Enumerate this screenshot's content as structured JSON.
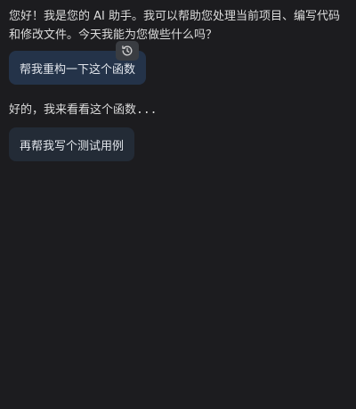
{
  "messages": [
    {
      "role": "assistant",
      "text": "您好！我是您的 AI 助手。我可以帮助您处理当前项目、编写代码和修改文件。今天我能为您做些什么吗？"
    },
    {
      "role": "user",
      "text": "帮我重构一下这个函数"
    },
    {
      "role": "assistant",
      "text": "好的，我来看看这个函数..."
    },
    {
      "role": "user",
      "text": "再帮我写个测试用例"
    }
  ],
  "icons": {
    "revert": "history-restore-icon"
  },
  "colors": {
    "background": "#1c1c1f",
    "user_bubble_active": "#243349",
    "user_bubble": "#232b36",
    "text": "#dcdcdc"
  }
}
